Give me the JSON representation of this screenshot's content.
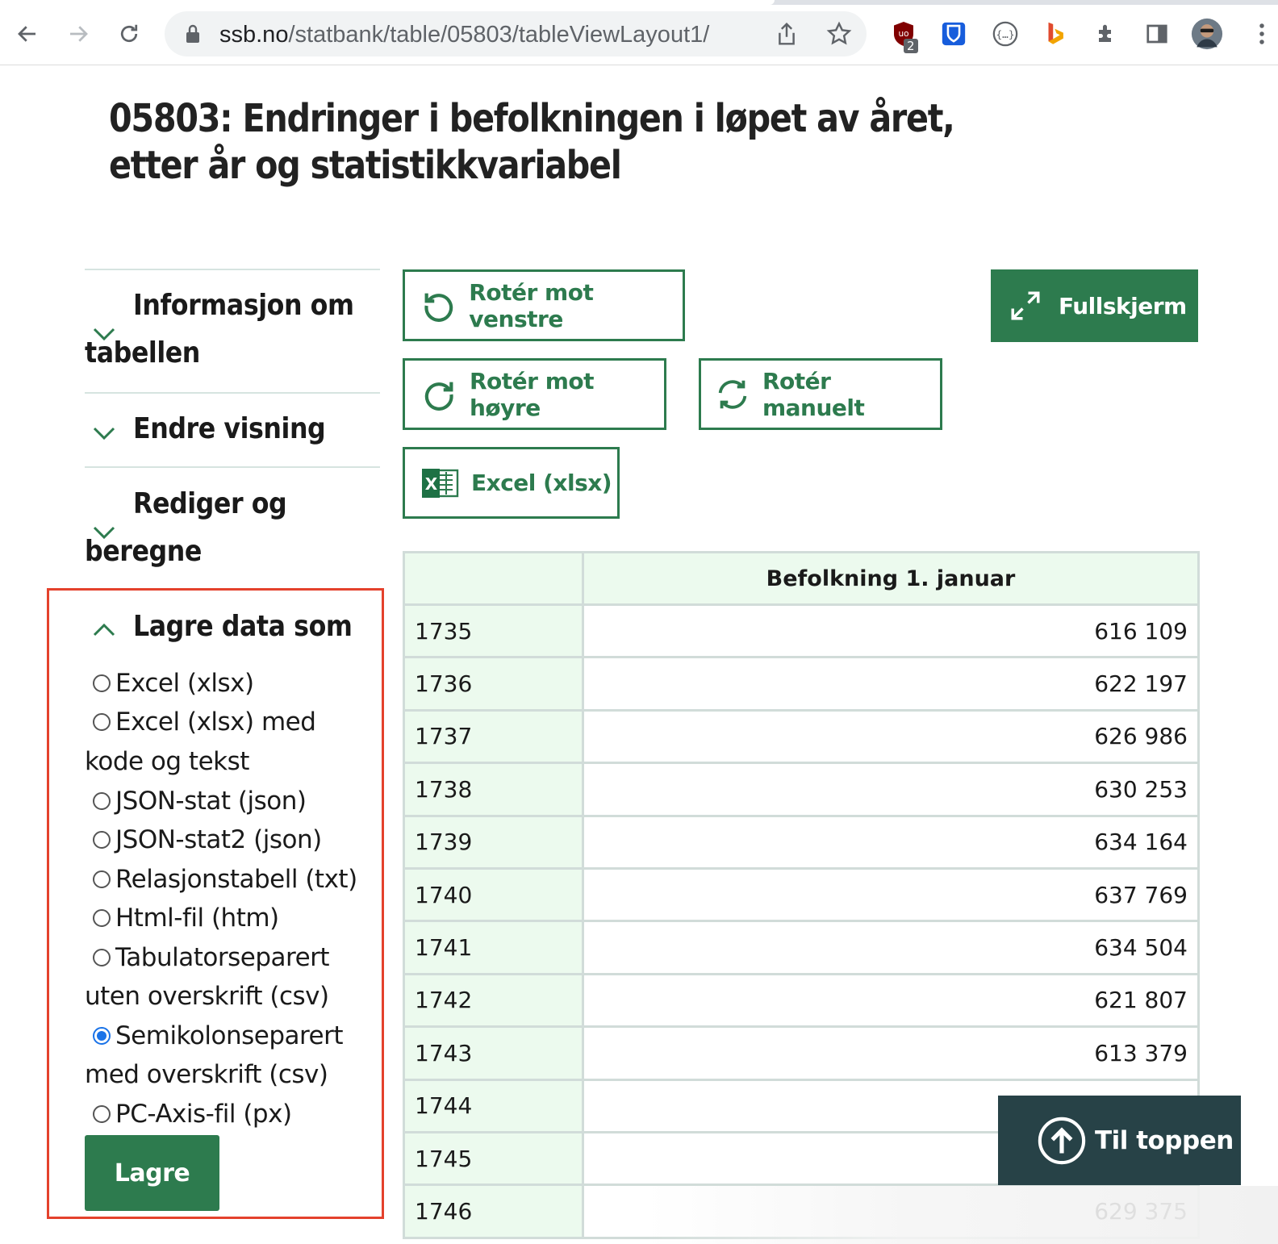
{
  "browser": {
    "url_host": "ssb.no",
    "url_path": "/statbank/table/05803/tableViewLayout1/",
    "extension_badge": "2"
  },
  "page": {
    "title": "05803: Endringer i befolkningen i løpet av året, etter år og statistikkvariabel"
  },
  "sidebar": {
    "info": {
      "line1": "Informasjon om",
      "line2": "tabellen"
    },
    "endre": "Endre visning",
    "rediger": {
      "line1": "Rediger og",
      "line2": "beregne"
    },
    "lagre_section": {
      "title": "Lagre data som",
      "options": [
        {
          "line1": "Excel (xlsx)",
          "line2": "",
          "checked": false
        },
        {
          "line1": "Excel (xlsx) med",
          "line2": "kode og tekst",
          "checked": false
        },
        {
          "line1": "JSON-stat (json)",
          "line2": "",
          "checked": false
        },
        {
          "line1": "JSON-stat2 (json)",
          "line2": "",
          "checked": false
        },
        {
          "line1": "Relasjonstabell (txt)",
          "line2": "",
          "checked": false
        },
        {
          "line1": "Html-fil (htm)",
          "line2": "",
          "checked": false
        },
        {
          "line1": "Tabulatorseparert",
          "line2": "uten overskrift (csv)",
          "checked": false
        },
        {
          "line1": "Semikolonseparert",
          "line2": "med overskrift (csv)",
          "checked": true
        },
        {
          "line1": "PC-Axis-fil (px)",
          "line2": "",
          "checked": false
        }
      ],
      "button": "Lagre"
    }
  },
  "toolbar": {
    "rotate_left": "Rotér mot venstre",
    "rotate_right": "Rotér mot høyre",
    "rotate_manual": "Rotér manuelt",
    "excel": "Excel (xlsx)",
    "fullscreen": "Fullskjerm"
  },
  "table": {
    "header_year": "",
    "header_value": "Befolkning 1. januar",
    "rows": [
      {
        "year": "1735",
        "value": "616 109"
      },
      {
        "year": "1736",
        "value": "622 197"
      },
      {
        "year": "1737",
        "value": "626 986"
      },
      {
        "year": "1738",
        "value": "630 253"
      },
      {
        "year": "1739",
        "value": "634 164"
      },
      {
        "year": "1740",
        "value": "637 769"
      },
      {
        "year": "1741",
        "value": "634 504"
      },
      {
        "year": "1742",
        "value": "621 807"
      },
      {
        "year": "1743",
        "value": "613 379"
      },
      {
        "year": "1744",
        "value": ""
      },
      {
        "year": "1745",
        "value": ""
      },
      {
        "year": "1746",
        "value": "629 375"
      }
    ]
  },
  "to_top": "Til toppen",
  "colors": {
    "brand_green": "#2d7b4e",
    "highlight_red": "#e4412c",
    "header_bg": "#ecfaee",
    "dark_button": "#274247"
  }
}
